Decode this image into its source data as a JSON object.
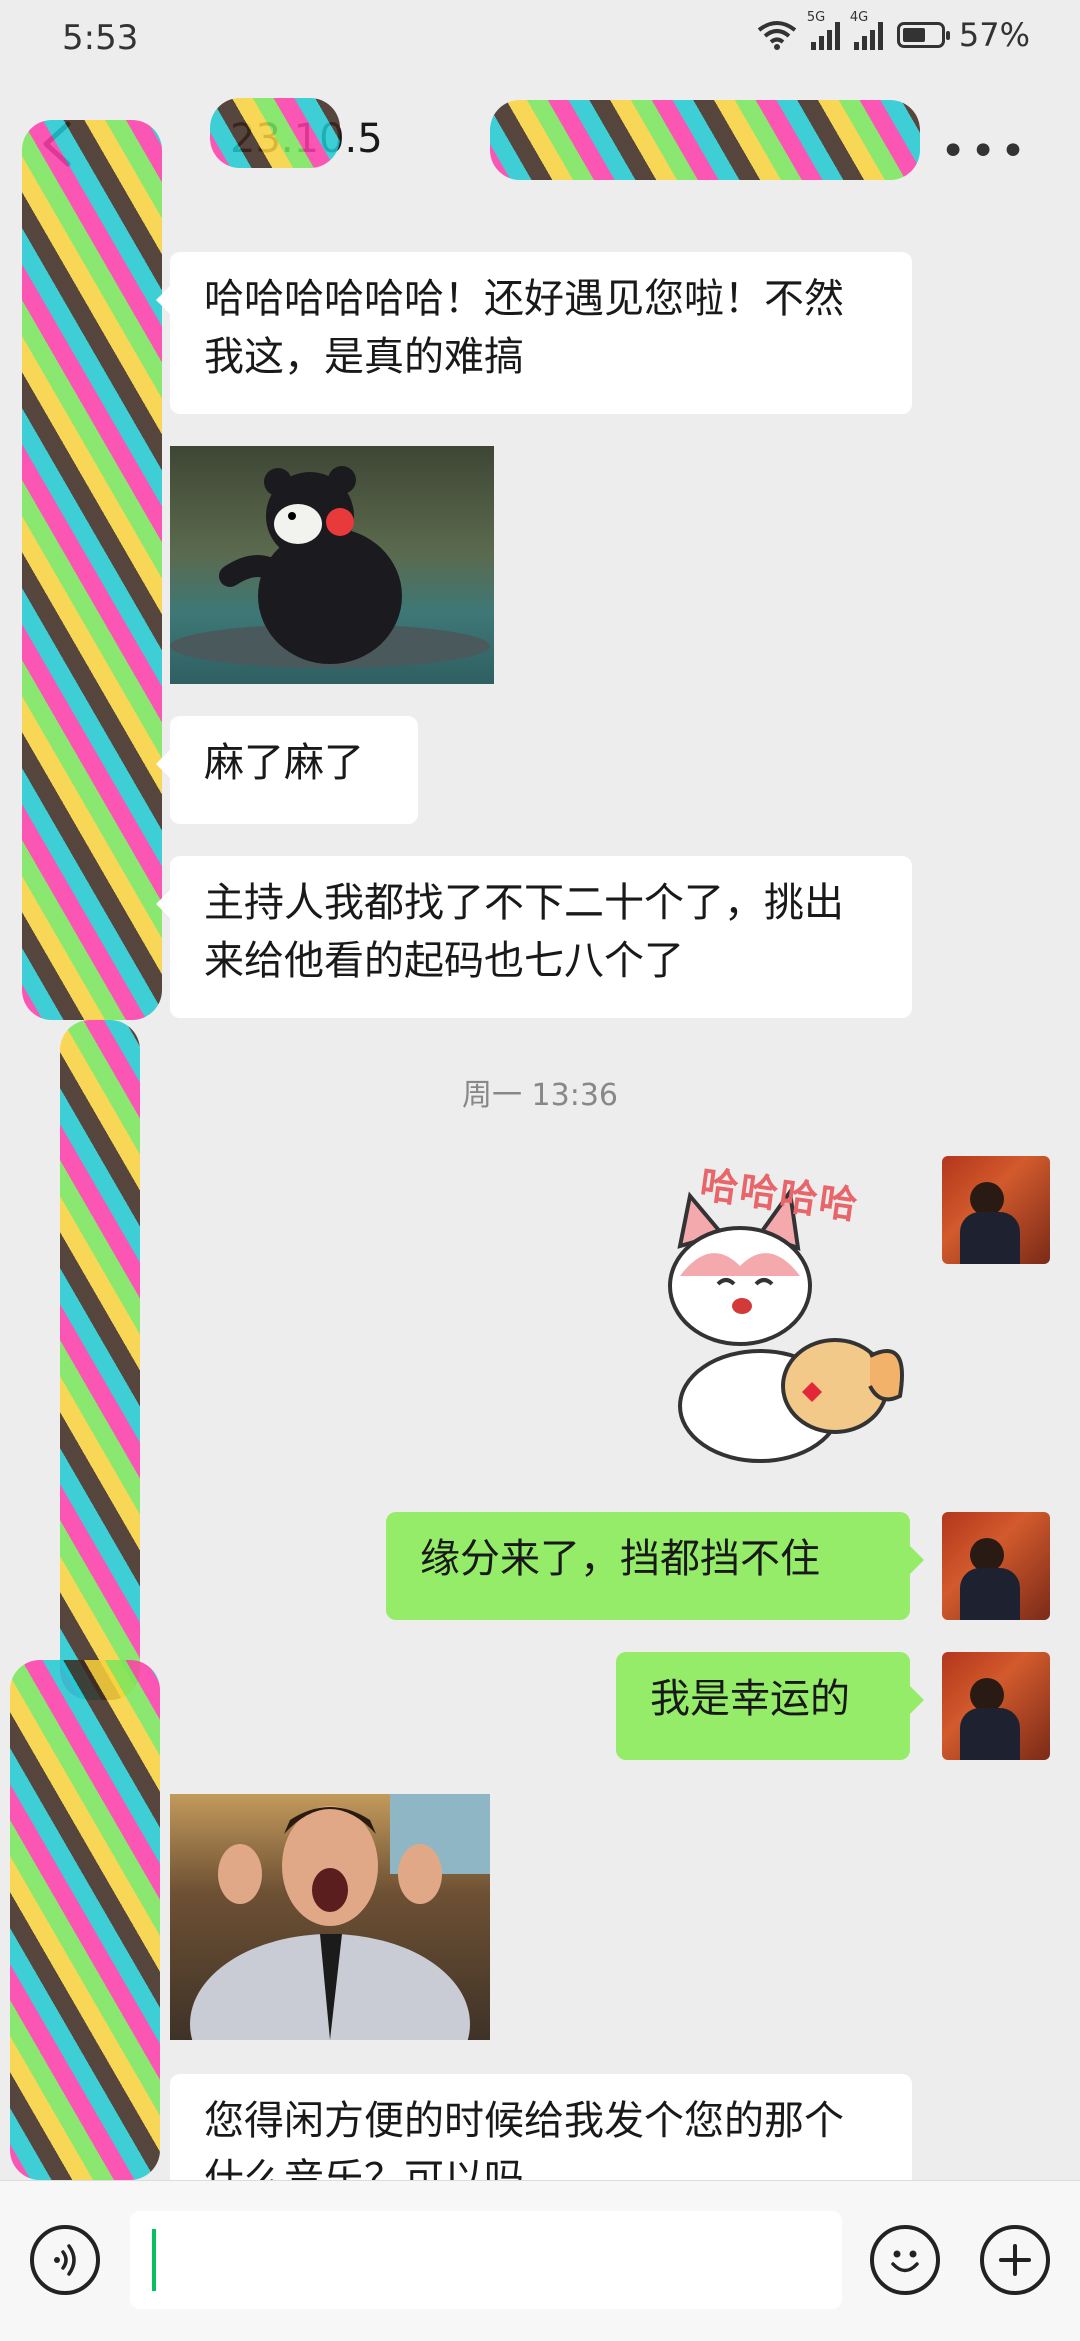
{
  "status": {
    "time": "5:53",
    "battery": "57%",
    "battery_level": 0.57,
    "net1": "5G",
    "net2": "4G"
  },
  "header": {
    "title": "23.10.5",
    "back_icon": "chevron-left-icon",
    "more_icon": "more-dots-icon"
  },
  "messages": [
    {
      "side": "left",
      "type": "text",
      "text": "哈哈哈哈哈哈！还好遇见您啦！不然我这，是真的难搞"
    },
    {
      "side": "left",
      "type": "image",
      "description": "kumamon-boat-sticker"
    },
    {
      "side": "left",
      "type": "text",
      "text": "麻了麻了"
    },
    {
      "side": "left",
      "type": "text",
      "text": "主持人我都找了不下二十个了，挑出来给他看的起码也七八个了"
    },
    {
      "type": "timestamp",
      "text": "周一 13:36"
    },
    {
      "side": "right",
      "type": "sticker",
      "text": "哈哈哈哈"
    },
    {
      "side": "right",
      "type": "text",
      "text": "缘分来了，挡都挡不住"
    },
    {
      "side": "right",
      "type": "text",
      "text": "我是幸运的"
    },
    {
      "side": "left",
      "type": "image",
      "description": "laughing-man-gif"
    },
    {
      "side": "left",
      "type": "text",
      "text": "您得闲方便的时候给我发个您的那个什么音乐？可以吗"
    }
  ],
  "inputbar": {
    "voice_icon": "voice-icon",
    "emoji_icon": "emoji-icon",
    "plus_icon": "plus-icon"
  }
}
